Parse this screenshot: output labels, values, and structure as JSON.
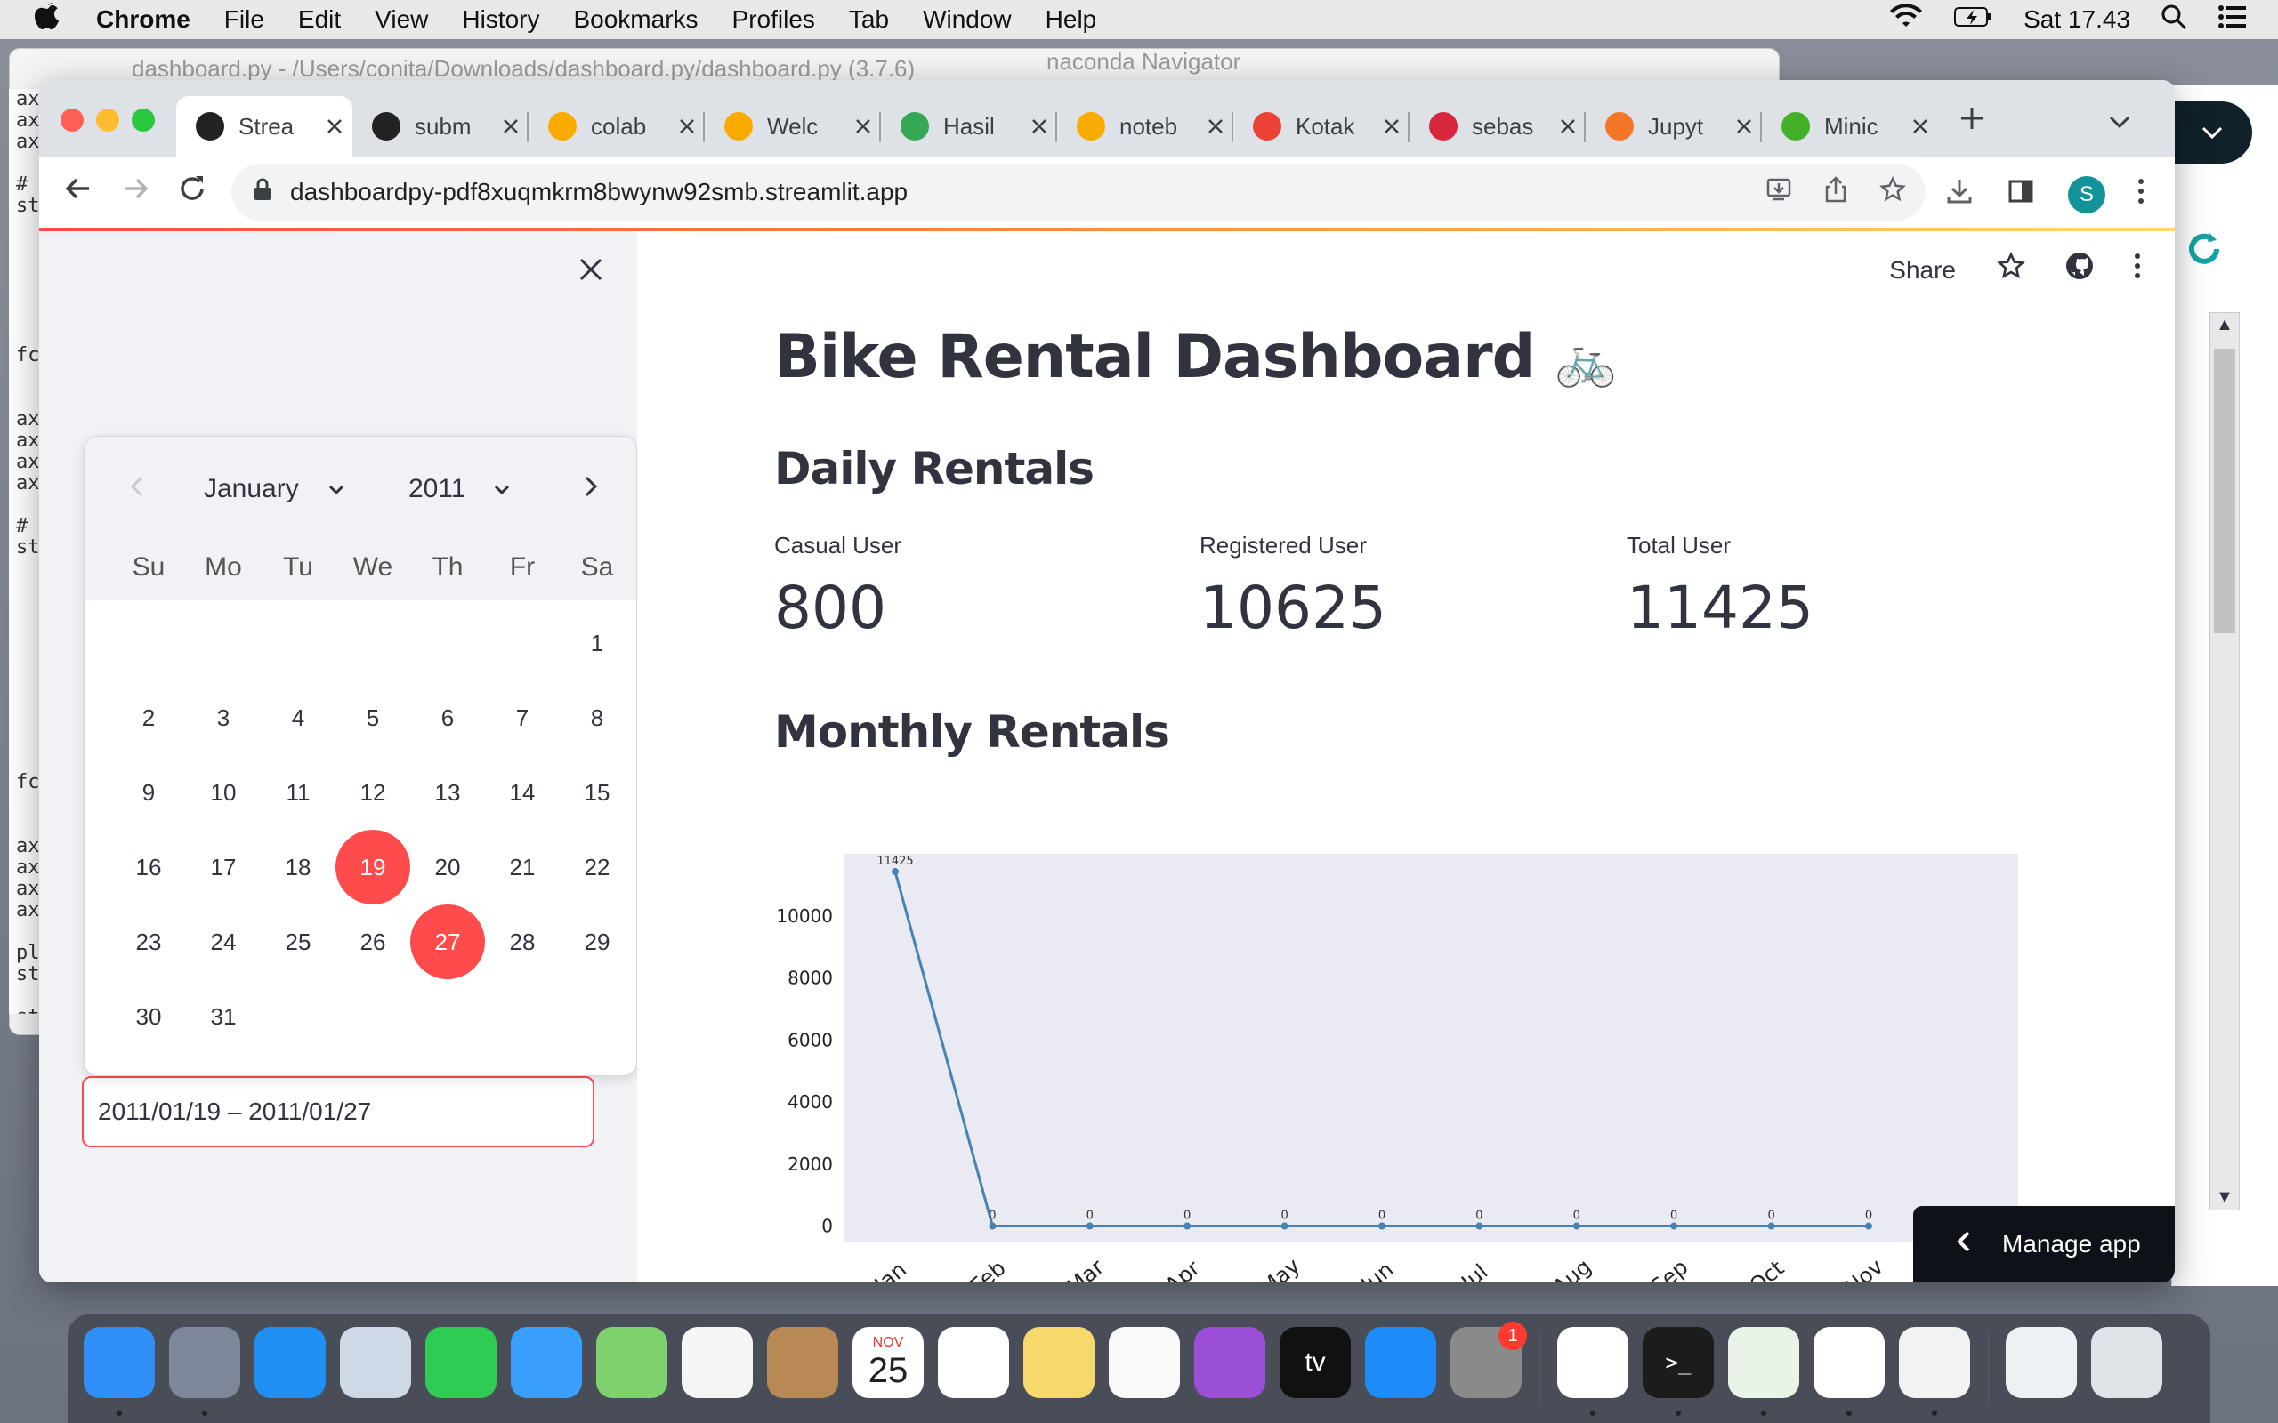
{
  "menubar": {
    "apple": "",
    "items": [
      "Chrome",
      "File",
      "Edit",
      "View",
      "History",
      "Bookmarks",
      "Profiles",
      "Tab",
      "Window",
      "Help"
    ],
    "clock": "Sat 17.43"
  },
  "background": {
    "window_title": "dashboard.py - /Users/conita/Downloads/dashboard.py/dashboard.py (3.7.6)",
    "anaconda_title": "naconda Navigator",
    "terminal_lines": [
      "ax",
      "ax",
      "ax",
      "",
      "#",
      "st",
      "",
      "",
      "",
      "",
      "",
      "",
      "fc",
      "",
      "",
      "ax",
      "ax",
      "ax",
      "ax",
      "",
      "#",
      "st",
      "",
      "",
      "",
      "",
      "",
      "",
      "",
      "",
      "",
      "",
      "fc",
      "",
      "",
      "ax",
      "ax",
      "ax",
      "ax",
      "",
      "pl",
      "st",
      "",
      "st"
    ]
  },
  "tabs": [
    {
      "label": "Strea",
      "icon": "streamlit-icon",
      "color": "#222222",
      "active": true
    },
    {
      "label": "subm",
      "icon": "github-icon",
      "color": "#222222"
    },
    {
      "label": "colab",
      "icon": "colab-icon",
      "color": "#f9ab00"
    },
    {
      "label": "Welc",
      "icon": "colab-icon",
      "color": "#f9ab00"
    },
    {
      "label": "Hasil",
      "icon": "drive-icon",
      "color": "#34a853"
    },
    {
      "label": "noteb",
      "icon": "colab-icon",
      "color": "#f9ab00"
    },
    {
      "label": "Kotak",
      "icon": "gmail-icon",
      "color": "#ea4335"
    },
    {
      "label": "sebas",
      "icon": "crown-icon",
      "color": "#d7263d"
    },
    {
      "label": "Jupyt",
      "icon": "jupyter-icon",
      "color": "#f37726"
    },
    {
      "label": "Minic",
      "icon": "miniconda-icon",
      "color": "#43b02a"
    }
  ],
  "address_bar": {
    "url": "dashboardpy-pdf8xuqmkrm8bwynw92smb.streamlit.app"
  },
  "header": {
    "share_label": "Share"
  },
  "main": {
    "title": "Bike Rental Dashboard",
    "title_emoji": "🚲",
    "daily_heading": "Daily Rentals",
    "monthly_heading": "Monthly Rentals",
    "metrics": [
      {
        "label": "Casual User",
        "value": "800"
      },
      {
        "label": "Registered User",
        "value": "10625"
      },
      {
        "label": "Total User",
        "value": "11425"
      }
    ]
  },
  "sidebar": {
    "date_range_value": "2011/01/19 – 2011/01/27"
  },
  "calendar": {
    "month": "January",
    "year": "2011",
    "weekdays": [
      "Su",
      "Mo",
      "Tu",
      "We",
      "Th",
      "Fr",
      "Sa"
    ],
    "first_weekday_index": 6,
    "days_in_month": 31,
    "selected_days": [
      19,
      27
    ]
  },
  "manage_app": {
    "label": "Manage app"
  },
  "chart_data": {
    "type": "line",
    "title": "",
    "xlabel": "",
    "ylabel": "",
    "categories": [
      "Jan",
      "Feb",
      "Mar",
      "Apr",
      "May",
      "Jun",
      "Jul",
      "Aug",
      "Sep",
      "Oct",
      "Nov"
    ],
    "values": [
      11425,
      0,
      0,
      0,
      0,
      0,
      0,
      0,
      0,
      0,
      0
    ],
    "point_labels": [
      "11425",
      "0",
      "0",
      "0",
      "0",
      "0",
      "0",
      "0",
      "0",
      "0",
      "0"
    ],
    "yticks": [
      0,
      2000,
      4000,
      6000,
      8000,
      10000
    ],
    "ylim": [
      -500,
      12000
    ],
    "line_color": "#4682b4",
    "background_color": "#eaeaf2",
    "grid": false
  },
  "dock": {
    "calendar_month": "NOV",
    "calendar_day": "25",
    "settings_badge": "1",
    "tv_label": "tv",
    "terminal_prompt": ">_",
    "items": [
      {
        "name": "finder-icon",
        "color": "#2f8ff7"
      },
      {
        "name": "launchpad-icon",
        "color": "#7d8799"
      },
      {
        "name": "safari-icon",
        "color": "#1f8ff4"
      },
      {
        "name": "mail-icon",
        "color": "#cfd8e6"
      },
      {
        "name": "facetime-icon",
        "color": "#2ecc52"
      },
      {
        "name": "messages-icon",
        "color": "#39a0ff"
      },
      {
        "name": "maps-icon",
        "color": "#7fd16e"
      },
      {
        "name": "photos-icon",
        "color": "#f5f5f5"
      },
      {
        "name": "contacts-icon",
        "color": "#b88955"
      },
      {
        "name": "calendar-icon",
        "color": "#ffffff"
      },
      {
        "name": "reminders-icon",
        "color": "#ffffff"
      },
      {
        "name": "notes-icon",
        "color": "#f7d96b"
      },
      {
        "name": "music-icon",
        "color": "#f9f9f9"
      },
      {
        "name": "podcasts-icon",
        "color": "#9b4fd6"
      },
      {
        "name": "apple-tv-icon",
        "color": "#111111"
      },
      {
        "name": "app-store-icon",
        "color": "#1e8cf8"
      },
      {
        "name": "system-preferences-icon",
        "color": "#8a8a8a"
      },
      {
        "name": "vscode-icon",
        "color": "#ffffff"
      },
      {
        "name": "terminal-icon",
        "color": "#1c1c1c"
      },
      {
        "name": "anaconda-icon",
        "color": "#e7f4e6"
      },
      {
        "name": "chrome-icon",
        "color": "#ffffff"
      },
      {
        "name": "python-launcher-icon",
        "color": "#f2f2f2"
      },
      {
        "name": "preview-icon",
        "color": "#eef1f4"
      },
      {
        "name": "trash-icon",
        "color": "#dfe3e8"
      }
    ]
  }
}
